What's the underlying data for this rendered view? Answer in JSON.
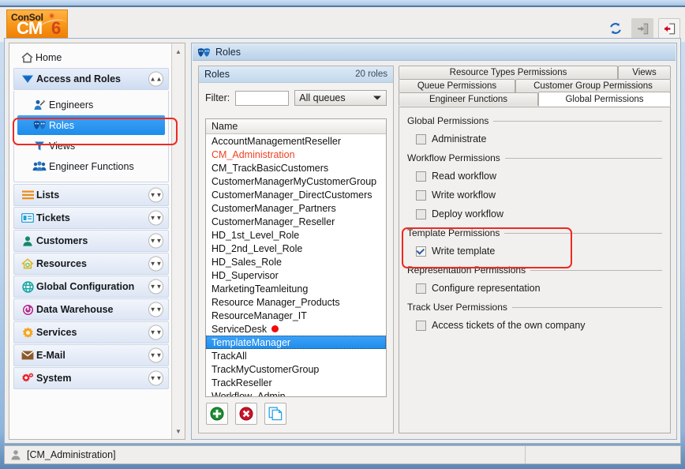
{
  "app": {
    "logo_line1": "ConSol",
    "logo_line2": "CM",
    "logo_six": "6"
  },
  "toolbar": {
    "refresh_label": "refresh-icon",
    "forward_label": "enter-icon",
    "logout_label": "logout-icon"
  },
  "sidebar": {
    "home": {
      "label": "Home",
      "icon": "home-icon"
    },
    "groups": [
      {
        "label": "Access and Roles",
        "icon": "access-roles-icon",
        "expanded": true,
        "chevron": "collapse-icon",
        "children": [
          {
            "label": "Engineers",
            "icon": "engineers-icon",
            "selected": false
          },
          {
            "label": "Roles",
            "icon": "roles-icon",
            "selected": true
          },
          {
            "label": "Views",
            "icon": "views-icon",
            "selected": false
          },
          {
            "label": "Engineer Functions",
            "icon": "engineer-functions-icon",
            "selected": false
          }
        ]
      },
      {
        "label": "Lists",
        "icon": "lists-icon",
        "expanded": false,
        "chevron": "expand-icon"
      },
      {
        "label": "Tickets",
        "icon": "tickets-icon",
        "expanded": false,
        "chevron": "expand-icon"
      },
      {
        "label": "Customers",
        "icon": "customers-icon",
        "expanded": false,
        "chevron": "expand-icon"
      },
      {
        "label": "Resources",
        "icon": "resources-icon",
        "expanded": false,
        "chevron": "expand-icon"
      },
      {
        "label": "Global Configuration",
        "icon": "global-config-icon",
        "expanded": false,
        "chevron": "expand-icon"
      },
      {
        "label": "Data Warehouse",
        "icon": "data-warehouse-icon",
        "expanded": false,
        "chevron": "expand-icon"
      },
      {
        "label": "Services",
        "icon": "services-icon",
        "expanded": false,
        "chevron": "expand-icon"
      },
      {
        "label": "E-Mail",
        "icon": "email-icon",
        "expanded": false,
        "chevron": "expand-icon"
      },
      {
        "label": "System",
        "icon": "system-icon",
        "expanded": false,
        "chevron": "expand-icon"
      }
    ]
  },
  "main": {
    "title": "Roles",
    "roles_panel": {
      "header_title": "Roles",
      "header_count": "20 roles",
      "filter_label": "Filter:",
      "filter_value": "",
      "filter_placeholder": "",
      "queue_selected": "All queues",
      "queue_options": [
        "All queues"
      ],
      "column_header": "Name",
      "rows": [
        {
          "name": "AccountManagementReseller",
          "style": "normal",
          "marker": false
        },
        {
          "name": "CM_Administration",
          "style": "red",
          "marker": false
        },
        {
          "name": "CM_TrackBasicCustomers",
          "style": "normal",
          "marker": false
        },
        {
          "name": "CustomerManagerMyCustomerGroup",
          "style": "normal",
          "marker": false
        },
        {
          "name": "CustomerManager_DirectCustomers",
          "style": "normal",
          "marker": false
        },
        {
          "name": "CustomerManager_Partners",
          "style": "normal",
          "marker": false
        },
        {
          "name": "CustomerManager_Reseller",
          "style": "normal",
          "marker": false
        },
        {
          "name": "HD_1st_Level_Role",
          "style": "normal",
          "marker": false
        },
        {
          "name": "HD_2nd_Level_Role",
          "style": "normal",
          "marker": false
        },
        {
          "name": "HD_Sales_Role",
          "style": "normal",
          "marker": false
        },
        {
          "name": "HD_Supervisor",
          "style": "normal",
          "marker": false
        },
        {
          "name": "MarketingTeamleitung",
          "style": "normal",
          "marker": false
        },
        {
          "name": "Resource Manager_Products",
          "style": "normal",
          "marker": false
        },
        {
          "name": "ResourceManager_IT",
          "style": "normal",
          "marker": false
        },
        {
          "name": "ServiceDesk",
          "style": "normal",
          "marker": true
        },
        {
          "name": "TemplateManager",
          "style": "selected",
          "marker": false
        },
        {
          "name": "TrackAll",
          "style": "normal",
          "marker": false
        },
        {
          "name": "TrackMyCustomerGroup",
          "style": "normal",
          "marker": false
        },
        {
          "name": "TrackReseller",
          "style": "normal",
          "marker": false
        },
        {
          "name": "Workflow_Admin",
          "style": "normal",
          "marker": false
        }
      ],
      "buttons": [
        {
          "name": "add-role-button",
          "icon": "plus-circle-icon"
        },
        {
          "name": "delete-role-button",
          "icon": "delete-circle-icon"
        },
        {
          "name": "copy-role-button",
          "icon": "copy-icon"
        }
      ]
    },
    "permissions_panel": {
      "tabs": [
        {
          "label": "Resource Types Permissions",
          "active": false
        },
        {
          "label": "Views",
          "active": false
        },
        {
          "label": "Queue Permissions",
          "active": false
        },
        {
          "label": "Customer Group Permissions",
          "active": false
        },
        {
          "label": "Engineer Functions",
          "active": false
        },
        {
          "label": "Global Permissions",
          "active": true
        }
      ],
      "sections": [
        {
          "label": "Global Permissions",
          "highlighted": false,
          "items": [
            {
              "label": "Administrate",
              "checked": false
            }
          ]
        },
        {
          "label": "Workflow Permissions",
          "highlighted": false,
          "items": [
            {
              "label": "Read workflow",
              "checked": false
            },
            {
              "label": "Write workflow",
              "checked": false
            },
            {
              "label": "Deploy workflow",
              "checked": false
            }
          ]
        },
        {
          "label": "Template Permissions",
          "highlighted": true,
          "items": [
            {
              "label": "Write template",
              "checked": true
            }
          ]
        },
        {
          "label": "Representation Permissions",
          "highlighted": false,
          "items": [
            {
              "label": "Configure representation",
              "checked": false
            }
          ]
        },
        {
          "label": "Track User Permissions",
          "highlighted": false,
          "items": [
            {
              "label": "Access tickets of the own company",
              "checked": false
            }
          ]
        }
      ]
    }
  },
  "statusbar": {
    "user_icon": "user-icon",
    "user_text": "[CM_Administration]"
  },
  "colors": {
    "accent_blue": "#1e8ceb",
    "highlight_red": "#ee2a22",
    "role_red": "#ef4123",
    "marker_red": "#f10b0b",
    "logo_orange": "#ef7d06"
  }
}
